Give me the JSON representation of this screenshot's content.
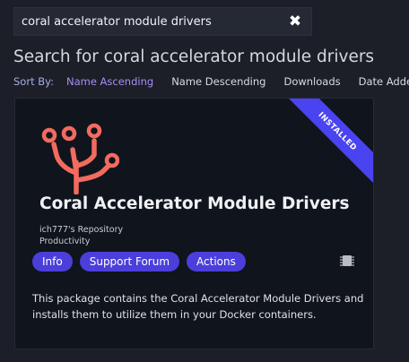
{
  "search": {
    "value": "coral accelerator module drivers"
  },
  "heading": "Search for coral accelerator module drivers",
  "sort": {
    "label": "Sort By:",
    "options": [
      "Name Ascending",
      "Name Descending",
      "Downloads",
      "Date Added"
    ],
    "active": "Name Ascending"
  },
  "card": {
    "ribbon": "INSTALLED",
    "title": "Coral Accelerator Module Drivers",
    "repository": "ich777's Repository",
    "category": "Productivity",
    "buttons": [
      "Info",
      "Support Forum",
      "Actions"
    ],
    "description": "This package contains the Coral Accelerator Module Drivers and installs them to utilize them in your Docker containers.",
    "logo_icon": "coral-logo-icon",
    "chip_icon": "chip-icon"
  },
  "colors": {
    "accent": "#4c3edb",
    "ribbon": "#4a43f0",
    "logo": "#f26b5f",
    "active_sort": "#a98cf7"
  }
}
